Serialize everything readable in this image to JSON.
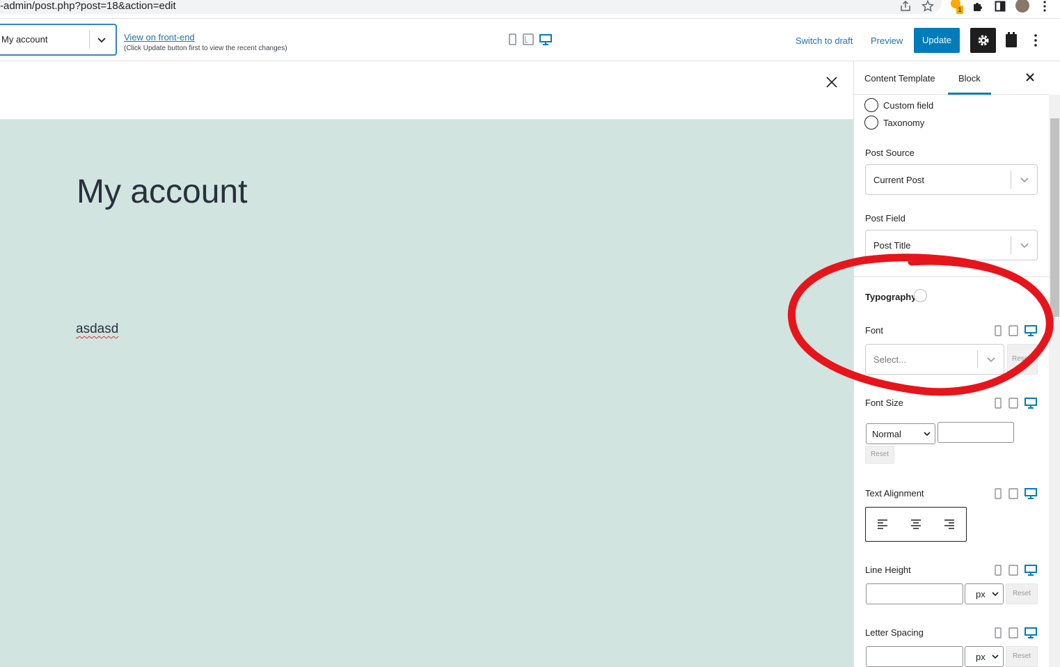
{
  "browser": {
    "url": "-admin/post.php?post=18&action=edit",
    "extension_badge_count": "1"
  },
  "header": {
    "template_select_value": "My account",
    "view_link": "View on front-end",
    "view_hint": "(Click Update button first to view the recent changes)",
    "switch_to_draft": "Switch to draft",
    "preview": "Preview",
    "update": "Update"
  },
  "canvas": {
    "background": "#d2e4df",
    "title": "My account",
    "body_text": "asdasd"
  },
  "sidebar": {
    "tabs": [
      {
        "label": "Content Template",
        "active": false
      },
      {
        "label": "Block",
        "active": true
      }
    ],
    "radio_options": [
      "Custom field",
      "Taxonomy"
    ],
    "post_source": {
      "label": "Post Source",
      "value": "Current Post"
    },
    "post_field": {
      "label": "Post Field",
      "value": "Post Title"
    },
    "typography": {
      "title": "Typography",
      "font": {
        "label": "Font",
        "placeholder": "Select...",
        "reset": "Reset"
      },
      "font_size": {
        "label": "Font Size",
        "select": "Normal",
        "reset": "Reset"
      },
      "text_alignment": {
        "label": "Text Alignment",
        "options": [
          "align-left",
          "align-center",
          "align-right"
        ]
      },
      "line_height": {
        "label": "Line Height",
        "unit": "px",
        "reset": "Reset"
      },
      "letter_spacing": {
        "label": "Letter Spacing",
        "unit": "px",
        "reset": "Reset"
      }
    }
  },
  "colors": {
    "accent": "#007cba",
    "link": "#2271b1",
    "annotation": "#e8141b"
  }
}
